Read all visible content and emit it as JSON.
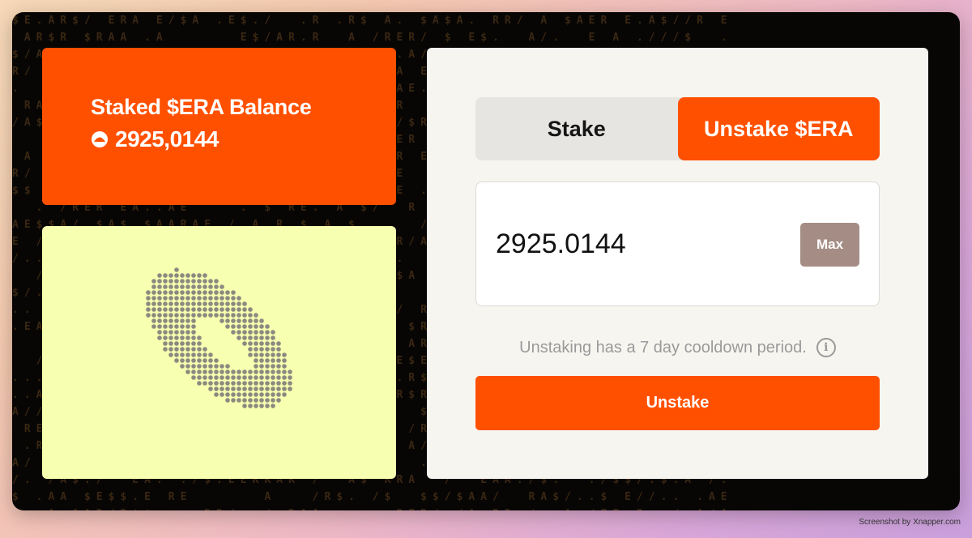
{
  "balance": {
    "title": "Staked $ERA Balance",
    "value": "2925,0144",
    "icon": "era-token-icon"
  },
  "tabs": [
    {
      "label": "Stake",
      "active": false
    },
    {
      "label": "Unstake $ERA",
      "active": true
    }
  ],
  "amount": {
    "value": "2925.0144",
    "max_label": "Max"
  },
  "notice": {
    "text": "Unstaking has a 7 day cooldown period.",
    "icon": "info-icon"
  },
  "action": {
    "label": "Unstake"
  },
  "credit": "Screenshot by Xnapper.com",
  "colors": {
    "accent": "#ff5000",
    "art_background": "#f7ffb0",
    "form_background": "#f7f5f0",
    "max_button": "#a58d85",
    "frame": "#070605"
  }
}
